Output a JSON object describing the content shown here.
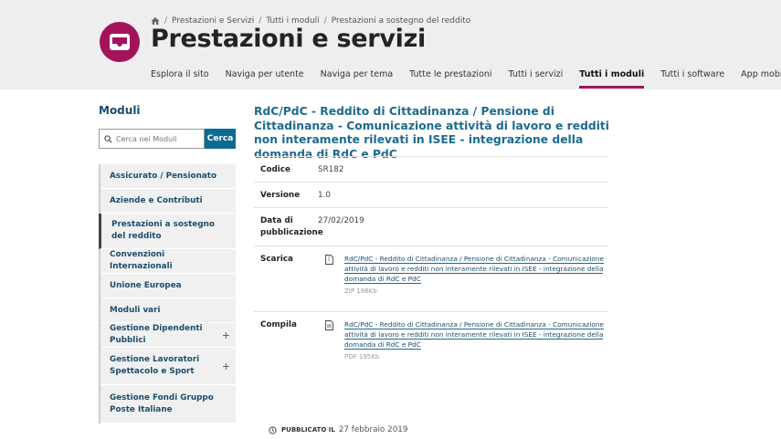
{
  "breadcrumb": {
    "items": [
      "Prestazioni e Servizi",
      "Tutti i moduli",
      "Prestazioni a sostegno del reddito"
    ]
  },
  "header": {
    "title": "Prestazioni e servizi",
    "logo_color": "#a3135c"
  },
  "nav": {
    "items": [
      "Esplora il sito",
      "Naviga per utente",
      "Naviga per tema",
      "Tutte le prestazioni",
      "Tutti i servizi",
      "Tutti i moduli",
      "Tutti i software",
      "App mobile"
    ],
    "active": "Tutti i moduli"
  },
  "sidebar": {
    "title": "Moduli",
    "search_placeholder": "Cerca nei Moduli",
    "search_button": "Cerca",
    "items": [
      {
        "label": "Assicurato / Pensionato",
        "expandable": false
      },
      {
        "label": "Aziende e Contributi",
        "expandable": false
      },
      {
        "label": "Prestazioni a sostegno del reddito",
        "expandable": false,
        "active": true
      },
      {
        "label": "Convenzioni Internazionali",
        "expandable": false
      },
      {
        "label": "Unione Europea",
        "expandable": false
      },
      {
        "label": "Moduli vari",
        "expandable": false
      },
      {
        "label": "Gestione Dipendenti Pubblici",
        "expandable": true
      },
      {
        "label": "Gestione Lavoratori Spettacolo e Sport",
        "expandable": true
      },
      {
        "label": "Gestione Fondi Gruppo Poste Italiane",
        "expandable": false
      }
    ],
    "plus_symbol": "+"
  },
  "content": {
    "title": "RdC/PdC - Reddito di Cittadinanza / Pensione di Cittadinanza - Comunicazione attività di lavoro e redditi non interamente rilevati in ISEE - integrazione della domanda di RdC e PdC",
    "codice_label": "Codice",
    "codice_value": "SR182",
    "versione_label": "Versione",
    "versione_value": "1.0",
    "data_label": "Data di pubblicazione",
    "data_value": "27/02/2019",
    "scarica_label": "Scarica",
    "scarica_link": "RdC/PdC - Reddito di Cittadinanza / Pensione di Cittadinanza - Comunicazione attività di lavoro e redditi non interamente rilevati in ISEE - integrazione della domanda di RdC e PdC",
    "scarica_meta": "ZIP 186Kb",
    "compila_label": "Compila",
    "compila_link": "RdC/PdC - Reddito di Cittadinanza / Pensione di Cittadinanza - Comunicazione attività di lavoro e redditi non interamente rilevati in ISEE - integrazione della domanda di RdC e PdC",
    "compila_meta": "PDF 195Kb"
  },
  "footer": {
    "published_label": "PUBBLICATO IL",
    "published_date": "27 febbraio 2019"
  },
  "colors": {
    "accent": "#a3135c",
    "link": "#1d6a8e",
    "button": "#0d6b91"
  }
}
